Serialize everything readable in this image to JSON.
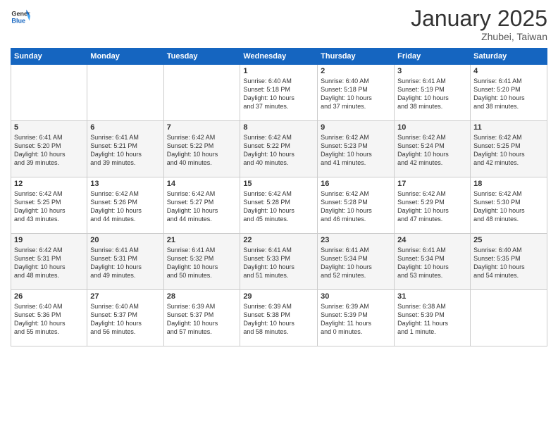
{
  "header": {
    "logo_general": "General",
    "logo_blue": "Blue",
    "month_title": "January 2025",
    "location": "Zhubei, Taiwan"
  },
  "weekdays": [
    "Sunday",
    "Monday",
    "Tuesday",
    "Wednesday",
    "Thursday",
    "Friday",
    "Saturday"
  ],
  "weeks": [
    [
      {
        "day": "",
        "info": ""
      },
      {
        "day": "",
        "info": ""
      },
      {
        "day": "",
        "info": ""
      },
      {
        "day": "1",
        "info": "Sunrise: 6:40 AM\nSunset: 5:18 PM\nDaylight: 10 hours\nand 37 minutes."
      },
      {
        "day": "2",
        "info": "Sunrise: 6:40 AM\nSunset: 5:18 PM\nDaylight: 10 hours\nand 37 minutes."
      },
      {
        "day": "3",
        "info": "Sunrise: 6:41 AM\nSunset: 5:19 PM\nDaylight: 10 hours\nand 38 minutes."
      },
      {
        "day": "4",
        "info": "Sunrise: 6:41 AM\nSunset: 5:20 PM\nDaylight: 10 hours\nand 38 minutes."
      }
    ],
    [
      {
        "day": "5",
        "info": "Sunrise: 6:41 AM\nSunset: 5:20 PM\nDaylight: 10 hours\nand 39 minutes."
      },
      {
        "day": "6",
        "info": "Sunrise: 6:41 AM\nSunset: 5:21 PM\nDaylight: 10 hours\nand 39 minutes."
      },
      {
        "day": "7",
        "info": "Sunrise: 6:42 AM\nSunset: 5:22 PM\nDaylight: 10 hours\nand 40 minutes."
      },
      {
        "day": "8",
        "info": "Sunrise: 6:42 AM\nSunset: 5:22 PM\nDaylight: 10 hours\nand 40 minutes."
      },
      {
        "day": "9",
        "info": "Sunrise: 6:42 AM\nSunset: 5:23 PM\nDaylight: 10 hours\nand 41 minutes."
      },
      {
        "day": "10",
        "info": "Sunrise: 6:42 AM\nSunset: 5:24 PM\nDaylight: 10 hours\nand 42 minutes."
      },
      {
        "day": "11",
        "info": "Sunrise: 6:42 AM\nSunset: 5:25 PM\nDaylight: 10 hours\nand 42 minutes."
      }
    ],
    [
      {
        "day": "12",
        "info": "Sunrise: 6:42 AM\nSunset: 5:25 PM\nDaylight: 10 hours\nand 43 minutes."
      },
      {
        "day": "13",
        "info": "Sunrise: 6:42 AM\nSunset: 5:26 PM\nDaylight: 10 hours\nand 44 minutes."
      },
      {
        "day": "14",
        "info": "Sunrise: 6:42 AM\nSunset: 5:27 PM\nDaylight: 10 hours\nand 44 minutes."
      },
      {
        "day": "15",
        "info": "Sunrise: 6:42 AM\nSunset: 5:28 PM\nDaylight: 10 hours\nand 45 minutes."
      },
      {
        "day": "16",
        "info": "Sunrise: 6:42 AM\nSunset: 5:28 PM\nDaylight: 10 hours\nand 46 minutes."
      },
      {
        "day": "17",
        "info": "Sunrise: 6:42 AM\nSunset: 5:29 PM\nDaylight: 10 hours\nand 47 minutes."
      },
      {
        "day": "18",
        "info": "Sunrise: 6:42 AM\nSunset: 5:30 PM\nDaylight: 10 hours\nand 48 minutes."
      }
    ],
    [
      {
        "day": "19",
        "info": "Sunrise: 6:42 AM\nSunset: 5:31 PM\nDaylight: 10 hours\nand 48 minutes."
      },
      {
        "day": "20",
        "info": "Sunrise: 6:41 AM\nSunset: 5:31 PM\nDaylight: 10 hours\nand 49 minutes."
      },
      {
        "day": "21",
        "info": "Sunrise: 6:41 AM\nSunset: 5:32 PM\nDaylight: 10 hours\nand 50 minutes."
      },
      {
        "day": "22",
        "info": "Sunrise: 6:41 AM\nSunset: 5:33 PM\nDaylight: 10 hours\nand 51 minutes."
      },
      {
        "day": "23",
        "info": "Sunrise: 6:41 AM\nSunset: 5:34 PM\nDaylight: 10 hours\nand 52 minutes."
      },
      {
        "day": "24",
        "info": "Sunrise: 6:41 AM\nSunset: 5:34 PM\nDaylight: 10 hours\nand 53 minutes."
      },
      {
        "day": "25",
        "info": "Sunrise: 6:40 AM\nSunset: 5:35 PM\nDaylight: 10 hours\nand 54 minutes."
      }
    ],
    [
      {
        "day": "26",
        "info": "Sunrise: 6:40 AM\nSunset: 5:36 PM\nDaylight: 10 hours\nand 55 minutes."
      },
      {
        "day": "27",
        "info": "Sunrise: 6:40 AM\nSunset: 5:37 PM\nDaylight: 10 hours\nand 56 minutes."
      },
      {
        "day": "28",
        "info": "Sunrise: 6:39 AM\nSunset: 5:37 PM\nDaylight: 10 hours\nand 57 minutes."
      },
      {
        "day": "29",
        "info": "Sunrise: 6:39 AM\nSunset: 5:38 PM\nDaylight: 10 hours\nand 58 minutes."
      },
      {
        "day": "30",
        "info": "Sunrise: 6:39 AM\nSunset: 5:39 PM\nDaylight: 11 hours\nand 0 minutes."
      },
      {
        "day": "31",
        "info": "Sunrise: 6:38 AM\nSunset: 5:39 PM\nDaylight: 11 hours\nand 1 minute."
      },
      {
        "day": "",
        "info": ""
      }
    ]
  ]
}
